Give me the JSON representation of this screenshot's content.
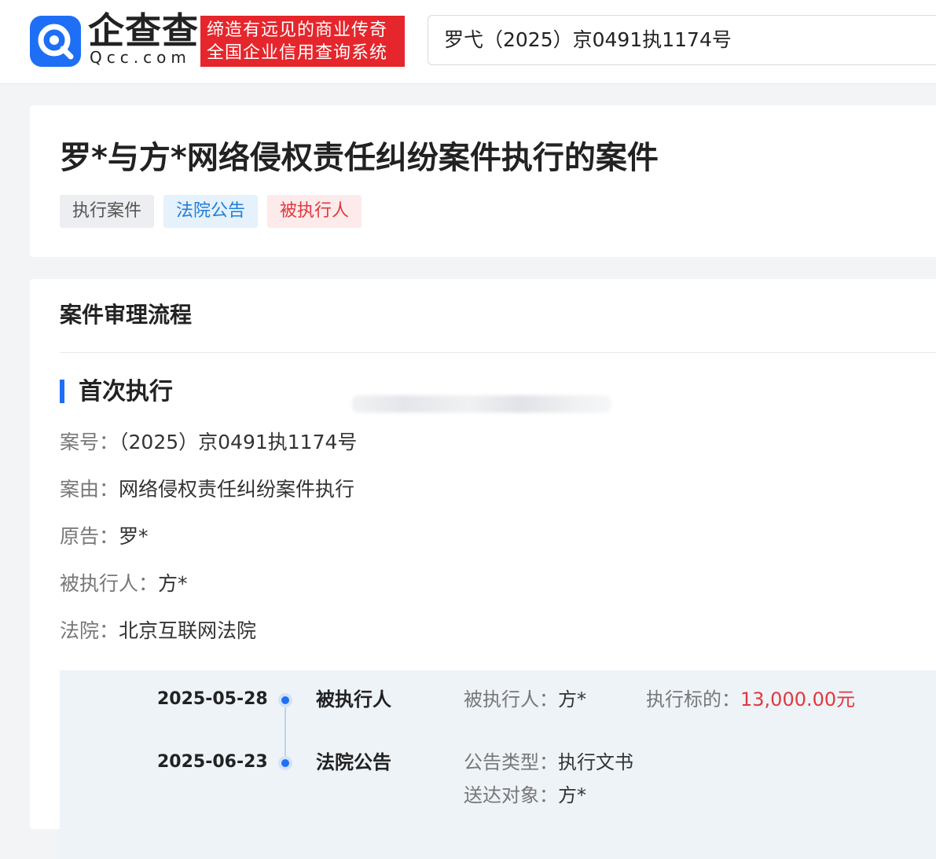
{
  "header": {
    "brand_cn": "企查查",
    "brand_en": "Qcc.com",
    "slogan_line1": "缔造有远见的商业传奇",
    "slogan_line2": "全国企业信用查询系统",
    "search_value": "罗弋（2025）京0491执1174号"
  },
  "case": {
    "title": "罗*与方*网络侵权责任纠纷案件执行的案件",
    "tags": [
      "执行案件",
      "法院公告",
      "被执行人"
    ]
  },
  "process": {
    "section_title": "案件审理流程",
    "phase_title": "首次执行",
    "fields": [
      {
        "label": "案号：",
        "value": "（2025）京0491执1174号"
      },
      {
        "label": "案由：",
        "value": "网络侵权责任纠纷案件执行"
      },
      {
        "label": "原告：",
        "value": "罗*"
      },
      {
        "label": "被执行人：",
        "value": "方*"
      },
      {
        "label": "法院：",
        "value": "北京互联网法院"
      }
    ],
    "timeline": [
      {
        "date": "2025-05-28",
        "type": "被执行人",
        "details": [
          {
            "label": "被执行人：",
            "value": "方*"
          },
          {
            "label": "执行标的：",
            "value": "13,000.00元"
          }
        ]
      },
      {
        "date": "2025-06-23",
        "type": "法院公告",
        "details": [
          {
            "label": "公告类型：",
            "value": "执行文书"
          },
          {
            "label": "送达对象：",
            "value": "方*"
          }
        ]
      }
    ]
  },
  "colors": {
    "brand_blue": "#1e6ff5",
    "slogan_red": "#e5262c",
    "amount_red": "#e0383e"
  },
  "icons": {
    "logo": "qcc-logo-icon"
  }
}
